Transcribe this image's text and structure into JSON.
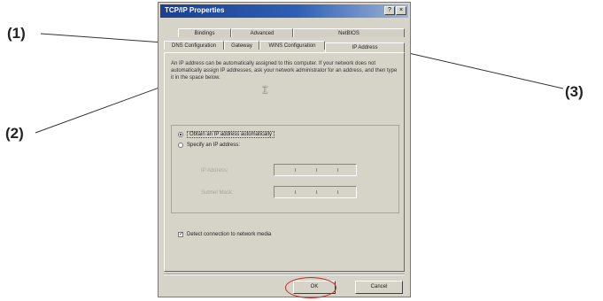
{
  "callouts": {
    "c1": "(1)",
    "c2": "(2)",
    "c3": "(3)"
  },
  "window": {
    "title": "TCP/IP Properties",
    "help_btn": "?",
    "close_btn": "×"
  },
  "tabs": {
    "row1": [
      "Bindings",
      "Advanced",
      "NetBIOS"
    ],
    "row2": [
      "DNS Configuration",
      "Gateway",
      "WINS Configuration",
      "IP Address"
    ]
  },
  "description": "An IP address can be automatically assigned to this computer. If your network does not automatically assign IP addresses, ask your network administrator for an address, and then type it in the space below.",
  "options": {
    "obtain_auto": "Obtain an IP address automatically",
    "specify": "Specify an IP address:",
    "ip_label": "IP Address:",
    "subnet_label": "Subnet Mask:"
  },
  "detect_media": "Detect connection to network media",
  "buttons": {
    "ok": "OK",
    "cancel": "Cancel"
  },
  "colors": {
    "highlight": "#c8282a",
    "title_bar": "#1d3f8f",
    "dialog_bg": "#d6d3c9"
  }
}
